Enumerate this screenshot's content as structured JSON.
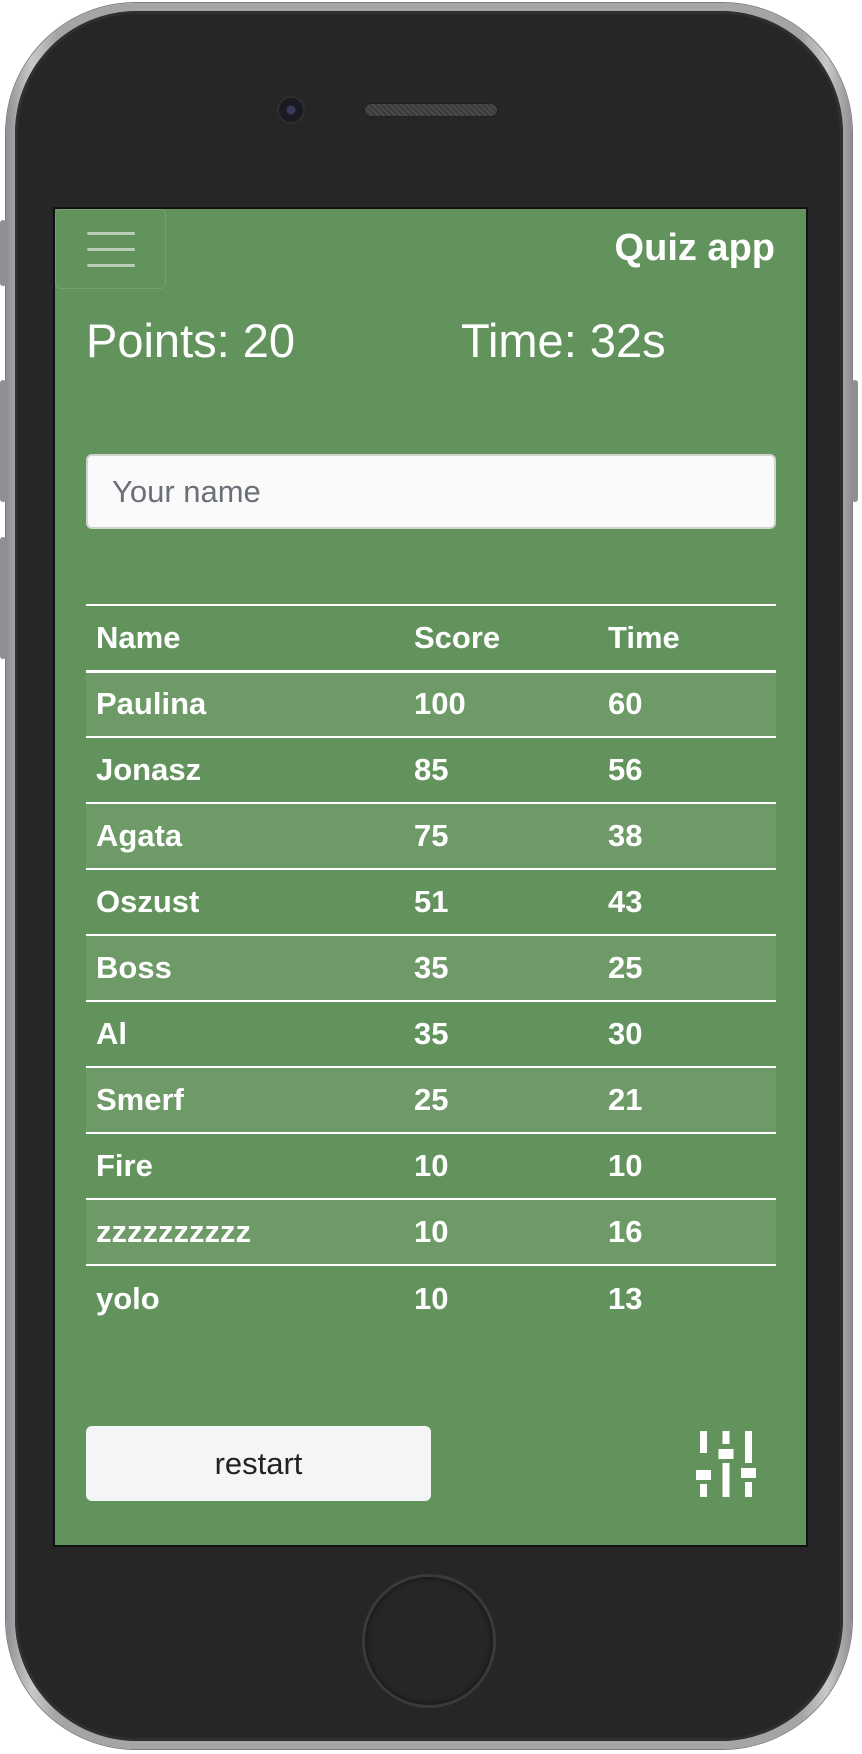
{
  "header": {
    "title": "Quiz app",
    "menu_icon": "hamburger-menu-icon"
  },
  "stats": {
    "points": "Points: 20",
    "time": "Time: 32s"
  },
  "name_input": {
    "value": "",
    "placeholder": "Your name"
  },
  "leaderboard": {
    "columns": [
      "Name",
      "Score",
      "Time"
    ],
    "rows": [
      {
        "name": "Paulina",
        "score": "100",
        "time": "60"
      },
      {
        "name": "Jonasz",
        "score": "85",
        "time": "56"
      },
      {
        "name": "Agata",
        "score": "75",
        "time": "38"
      },
      {
        "name": "Oszust",
        "score": "51",
        "time": "43"
      },
      {
        "name": "Boss",
        "score": "35",
        "time": "25"
      },
      {
        "name": "Al",
        "score": "35",
        "time": "30"
      },
      {
        "name": "Smerf",
        "score": "25",
        "time": "21"
      },
      {
        "name": "Fire",
        "score": "10",
        "time": "10"
      },
      {
        "name": "zzzzzzzzzz",
        "score": "10",
        "time": "16"
      },
      {
        "name": "yolo",
        "score": "10",
        "time": "13"
      }
    ]
  },
  "footer": {
    "restart_label": "restart",
    "settings_icon": "sliders-icon"
  },
  "colors": {
    "screen_bg": "#63935c",
    "phone_body": "#262626",
    "text": "#ffffff"
  }
}
